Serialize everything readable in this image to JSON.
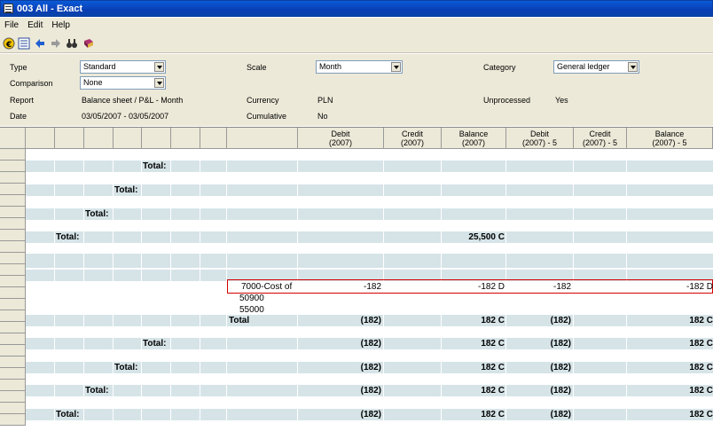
{
  "window": {
    "title": "003 All - Exact"
  },
  "menu": [
    "File",
    "Edit",
    "Help"
  ],
  "toolbar": {
    "icons": [
      "currency-icon",
      "list-icon",
      "back-arrow-icon",
      "forward-arrow-icon",
      "binoculars-icon",
      "book-icon"
    ]
  },
  "params": {
    "type_label": "Type",
    "type_value": "Standard",
    "comparison_label": "Comparison",
    "comparison_value": "None",
    "report_label": "Report",
    "report_value": "Balance sheet / P&L - Month",
    "date_label": "Date",
    "date_value": "03/05/2007 - 03/05/2007",
    "scale_label": "Scale",
    "scale_value": "Month",
    "currency_label": "Currency",
    "currency_value": "PLN",
    "cumulative_label": "Cumulative",
    "cumulative_value": "No",
    "category_label": "Category",
    "category_value": "General ledger",
    "unprocessed_label": "Unprocessed",
    "unprocessed_value": "Yes"
  },
  "columns": {
    "debit": [
      "Debit",
      "(2007)"
    ],
    "credit": [
      "Credit",
      "(2007)"
    ],
    "balance": [
      "Balance",
      "(2007)"
    ],
    "debit5": [
      "Debit",
      "(2007) - 5"
    ],
    "credit5": [
      "Credit",
      "(2007) - 5"
    ],
    "balance5": [
      "Balance",
      "(2007) - 5"
    ]
  },
  "rows": {
    "total_label": "Total:",
    "total_plain": "Total",
    "grand_balance": "25,500 C",
    "account_name": "7000-Cost of",
    "account_debit": "-182",
    "account_balance": "-182 D",
    "account_debit5": "-182",
    "account_balance5": "-182 D",
    "sub1": "50900",
    "sub2": "55000",
    "neg": "(182)",
    "credit_bal": "182 C",
    "bal5_partial": "182 C"
  }
}
